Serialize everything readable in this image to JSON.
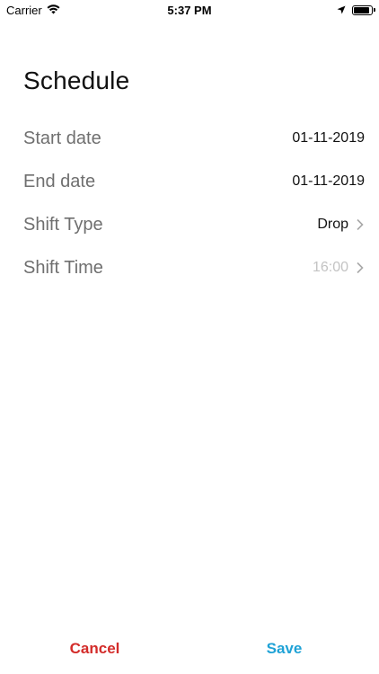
{
  "status_bar": {
    "carrier": "Carrier",
    "time": "5:37 PM",
    "battery_level": 0.9
  },
  "page": {
    "title": "Schedule"
  },
  "form": {
    "rows": [
      {
        "label": "Start date",
        "value": "01-11-2019",
        "has_chevron": false,
        "placeholder": false
      },
      {
        "label": "End date",
        "value": "01-11-2019",
        "has_chevron": false,
        "placeholder": false
      },
      {
        "label": "Shift Type",
        "value": "Drop",
        "has_chevron": true,
        "placeholder": false
      },
      {
        "label": "Shift Time",
        "value": "16:00",
        "has_chevron": true,
        "placeholder": true
      }
    ]
  },
  "actions": {
    "cancel_label": "Cancel",
    "save_label": "Save"
  },
  "colors": {
    "cancel": "#d32c2a",
    "save": "#1fa2d6",
    "label": "#6f6f6f",
    "placeholder": "#c3c3c3"
  },
  "icons": {
    "wifi": "wifi-icon",
    "location": "location-arrow-icon",
    "battery": "battery-icon",
    "chevron": "chevron-right-icon"
  }
}
